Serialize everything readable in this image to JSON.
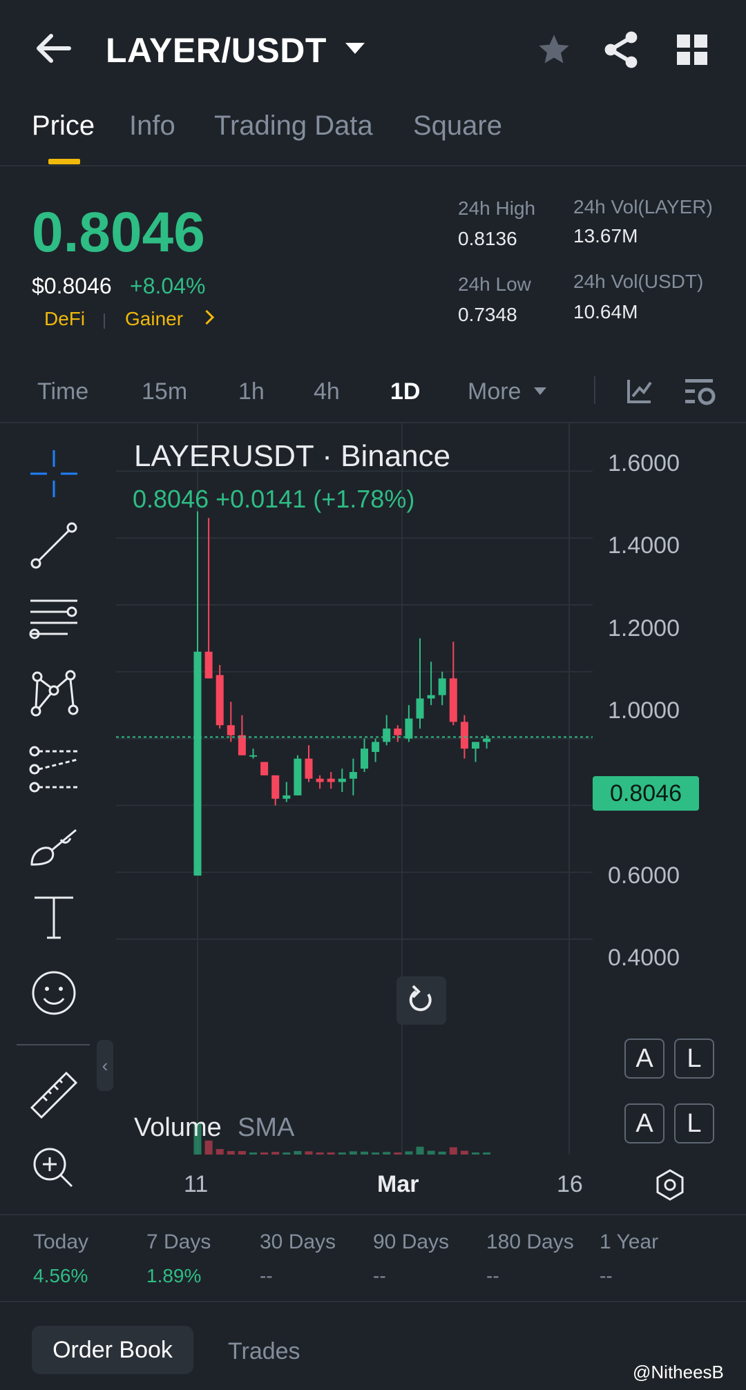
{
  "header": {
    "pair": "LAYER/USDT"
  },
  "tabs": [
    "Price",
    "Info",
    "Trading Data",
    "Square"
  ],
  "price": {
    "last": "0.8046",
    "usd": "$0.8046",
    "change_pct": "+8.04%",
    "tags": [
      "DeFi",
      "Gainer"
    ],
    "high_label": "24h High",
    "high": "0.8136",
    "low_label": "24h Low",
    "low": "0.7348",
    "vol_base_label": "24h Vol(LAYER)",
    "vol_base": "13.67M",
    "vol_quote_label": "24h Vol(USDT)",
    "vol_quote": "10.64M"
  },
  "timeframes": [
    "Time",
    "15m",
    "1h",
    "4h",
    "1D",
    "More"
  ],
  "active_timeframe": "1D",
  "chart": {
    "title": "LAYERUSDT · Binance",
    "quote": "0.8046  +0.0141 (+1.78%)",
    "y_ticks": [
      "1.6000",
      "1.4000",
      "1.2000",
      "1.0000",
      "0.8000",
      "0.6000",
      "0.4000"
    ],
    "last_price_tag": "0.8046",
    "x_ticks": [
      "11",
      "Mar",
      "16"
    ],
    "volume_label": "Volume",
    "volume_sma": "SMA",
    "al_buttons": [
      "A",
      "L"
    ],
    "collapse_glyph": "‹"
  },
  "chart_data": {
    "type": "candlestick",
    "title": "LAYERUSDT · Binance",
    "ylim": [
      0.2,
      1.7
    ],
    "last_price": 0.8046,
    "colors": {
      "up": "#2ebd85",
      "down": "#f6465d"
    },
    "candles": [
      {
        "o": 0.39,
        "h": 1.48,
        "l": 0.39,
        "c": 1.06
      },
      {
        "o": 1.06,
        "h": 1.46,
        "l": 0.98,
        "c": 0.98
      },
      {
        "o": 0.99,
        "h": 1.02,
        "l": 0.83,
        "c": 0.84
      },
      {
        "o": 0.84,
        "h": 0.91,
        "l": 0.79,
        "c": 0.81
      },
      {
        "o": 0.81,
        "h": 0.87,
        "l": 0.75,
        "c": 0.75
      },
      {
        "o": 0.75,
        "h": 0.77,
        "l": 0.74,
        "c": 0.75
      },
      {
        "o": 0.73,
        "h": 0.73,
        "l": 0.69,
        "c": 0.69
      },
      {
        "o": 0.69,
        "h": 0.69,
        "l": 0.6,
        "c": 0.62
      },
      {
        "o": 0.62,
        "h": 0.67,
        "l": 0.61,
        "c": 0.63
      },
      {
        "o": 0.63,
        "h": 0.75,
        "l": 0.63,
        "c": 0.74
      },
      {
        "o": 0.74,
        "h": 0.78,
        "l": 0.67,
        "c": 0.68
      },
      {
        "o": 0.68,
        "h": 0.69,
        "l": 0.65,
        "c": 0.67
      },
      {
        "o": 0.68,
        "h": 0.7,
        "l": 0.65,
        "c": 0.67
      },
      {
        "o": 0.67,
        "h": 0.71,
        "l": 0.64,
        "c": 0.68
      },
      {
        "o": 0.68,
        "h": 0.74,
        "l": 0.63,
        "c": 0.7
      },
      {
        "o": 0.71,
        "h": 0.8,
        "l": 0.7,
        "c": 0.77
      },
      {
        "o": 0.76,
        "h": 0.8,
        "l": 0.73,
        "c": 0.79
      },
      {
        "o": 0.79,
        "h": 0.87,
        "l": 0.78,
        "c": 0.83
      },
      {
        "o": 0.83,
        "h": 0.84,
        "l": 0.79,
        "c": 0.81
      },
      {
        "o": 0.8,
        "h": 0.9,
        "l": 0.79,
        "c": 0.86
      },
      {
        "o": 0.86,
        "h": 1.1,
        "l": 0.83,
        "c": 0.92
      },
      {
        "o": 0.92,
        "h": 1.03,
        "l": 0.9,
        "c": 0.93
      },
      {
        "o": 0.93,
        "h": 1.0,
        "l": 0.9,
        "c": 0.98
      },
      {
        "o": 0.98,
        "h": 1.09,
        "l": 0.84,
        "c": 0.85
      },
      {
        "o": 0.85,
        "h": 0.87,
        "l": 0.74,
        "c": 0.77
      },
      {
        "o": 0.77,
        "h": 0.79,
        "l": 0.73,
        "c": 0.79
      },
      {
        "o": 0.79,
        "h": 0.81,
        "l": 0.77,
        "c": 0.8
      }
    ]
  },
  "performance": [
    {
      "label": "Today",
      "value": "4.56%"
    },
    {
      "label": "7 Days",
      "value": "1.89%"
    },
    {
      "label": "30 Days",
      "value": "--"
    },
    {
      "label": "90 Days",
      "value": "--"
    },
    {
      "label": "180 Days",
      "value": "--"
    },
    {
      "label": "1 Year",
      "value": "--"
    }
  ],
  "bottom_tabs": [
    "Order Book",
    "Trades"
  ],
  "watermark": "@NitheesB"
}
